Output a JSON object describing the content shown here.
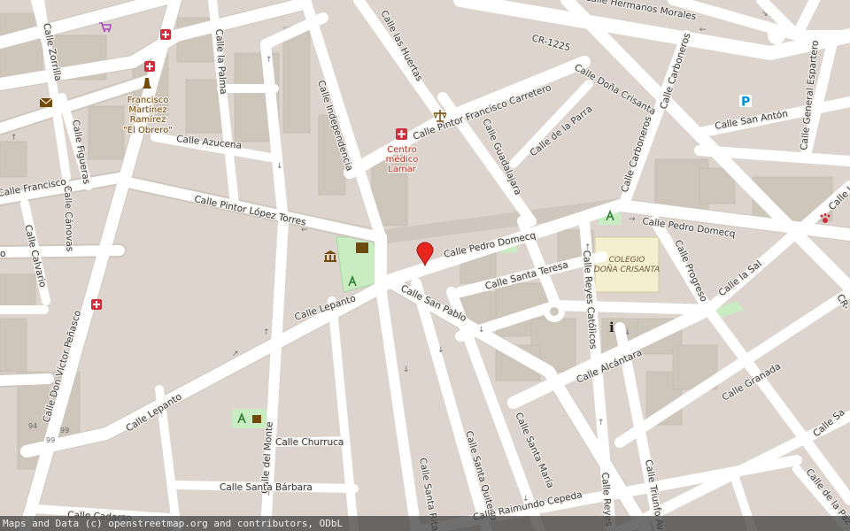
{
  "colors": {
    "background": "#ddd5cd",
    "building": "#cfc6bc",
    "road": "#ffffff",
    "park": "#c8ecc4",
    "school_area": "#f5efce",
    "marker": "#e8261e",
    "pharmacy": "#cf2e3a",
    "attribution_bg": "#464646"
  },
  "streets": [
    {
      "id": "zorrilla",
      "label": "Calle Zorrilla"
    },
    {
      "id": "la-palma",
      "label": "Calle la Palma"
    },
    {
      "id": "independencia",
      "label": "Calle Independencia"
    },
    {
      "id": "huertas",
      "label": "Calle las Huertas"
    },
    {
      "id": "morales",
      "label": "Calle Hermanos Morales"
    },
    {
      "id": "cr1225",
      "label": "CR-1225"
    },
    {
      "id": "dona-crisanta",
      "label": "Calle Doña Crisanta"
    },
    {
      "id": "carboneros-top",
      "label": "Calle Carboneros"
    },
    {
      "id": "espartero",
      "label": "Calle General Espartero"
    },
    {
      "id": "san-anton",
      "label": "Calle San Antón"
    },
    {
      "id": "pintor-carretero",
      "label": "Calle Pintor Francisco Carretero"
    },
    {
      "id": "parra",
      "label": "Calle de la Parra"
    },
    {
      "id": "guadalajara",
      "label": "Calle Guadalajara"
    },
    {
      "id": "carboneros",
      "label": "Calle Carboneros"
    },
    {
      "id": "figueras",
      "label": "Calle Figueras"
    },
    {
      "id": "azucena",
      "label": "Calle Azucena"
    },
    {
      "id": "francisco",
      "label": "Calle Francisco"
    },
    {
      "id": "canovas",
      "label": "Calle Cánovas"
    },
    {
      "id": "pintor-lopez",
      "label": "Calle Pintor López Torres"
    },
    {
      "id": "pedro-domecq",
      "label": "Calle Pedro Domecq"
    },
    {
      "id": "pedro-domecq-2",
      "label": "Calle Pedro Domecq"
    },
    {
      "id": "la-sal",
      "label": "Calle la Sal"
    },
    {
      "id": "calvario",
      "label": "Calle Calvario"
    },
    {
      "id": "santa-teresa",
      "label": "Calle Santa Teresa"
    },
    {
      "id": "reyes-catolicos",
      "label": "Calle Reyes Católicos"
    },
    {
      "id": "progreso",
      "label": "Calle Progreso"
    },
    {
      "id": "lepanto",
      "label": "Calle Lepanto"
    },
    {
      "id": "san-pablo",
      "label": "Calle San Pablo"
    },
    {
      "id": "victor",
      "label": "Calle Don Víctor Peñasco"
    },
    {
      "id": "alcantara",
      "label": "Calle Alcántara"
    },
    {
      "id": "granada",
      "label": "Calle Granada"
    },
    {
      "id": "lepanto-2",
      "label": "Calle Lepanto"
    },
    {
      "id": "santa-maria",
      "label": "Calle Santa María"
    },
    {
      "id": "santa-quiteria",
      "label": "Calle Santa Quiteria"
    },
    {
      "id": "santa-rita",
      "label": "Calle Santa Rita"
    },
    {
      "id": "del-monte",
      "label": "Calle del Monte"
    },
    {
      "id": "churruca",
      "label": "Calle Churruca"
    },
    {
      "id": "santa-barbara",
      "label": "Calle Santa Bárbara"
    },
    {
      "id": "cadarso",
      "label": "Calle Cadarso"
    },
    {
      "id": "raimundo",
      "label": "Calle Raimundo Cepeda"
    },
    {
      "id": "reyes-2",
      "label": "Calle Reyes"
    },
    {
      "id": "triunfo",
      "label": "Calle Triunfo Av"
    },
    {
      "id": "la-paz",
      "label": "Calle de la Paz"
    },
    {
      "id": "sa-edge",
      "label": "Calle Sa"
    },
    {
      "id": "la-edge",
      "label": "Calle la"
    },
    {
      "id": "cr-edge",
      "label": "CR-"
    },
    {
      "id": "o-edge",
      "label": "o"
    }
  ],
  "pois": {
    "poi_francisco": {
      "lines": [
        "Francisco",
        "Martínez",
        "Ramírez",
        "\"El Obrero\""
      ]
    },
    "poi_centro": {
      "lines": [
        "Centro",
        "médico",
        "Lamar"
      ]
    },
    "poi_colegio": {
      "lines": [
        "COLEGIO",
        "DOÑA CRISANTA"
      ]
    }
  },
  "house_numbers": [
    "94",
    "99",
    "99"
  ],
  "icons": [
    "shopping-cart-icon",
    "pharmacy-icon",
    "monument-icon",
    "post-office-icon",
    "courthouse-icon",
    "parking-icon",
    "museum-icon",
    "playground-icon",
    "information-icon",
    "veterinary-icon",
    "location-marker-icon"
  ],
  "attribution": "Maps and Data (c) openstreetmap.org and contributors, ODbL"
}
